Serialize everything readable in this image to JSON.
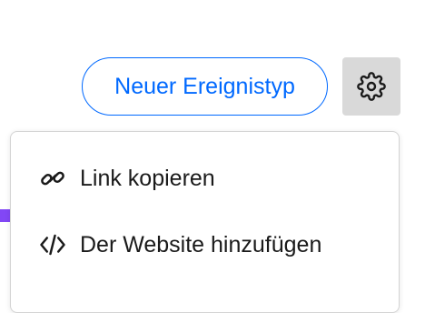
{
  "header": {
    "new_event_type_label": "Neuer Ereignistyp",
    "settings_icon": "gear-icon"
  },
  "dropdown": {
    "items": [
      {
        "label": "Link kopieren",
        "icon": "link-icon"
      },
      {
        "label": "Der Website hinzufügen",
        "icon": "code-icon"
      }
    ]
  },
  "colors": {
    "accent": "#0069ff",
    "settings_bg": "#d9d9d9",
    "purple_strip": "#8247f5",
    "text": "#1a1a1a"
  }
}
